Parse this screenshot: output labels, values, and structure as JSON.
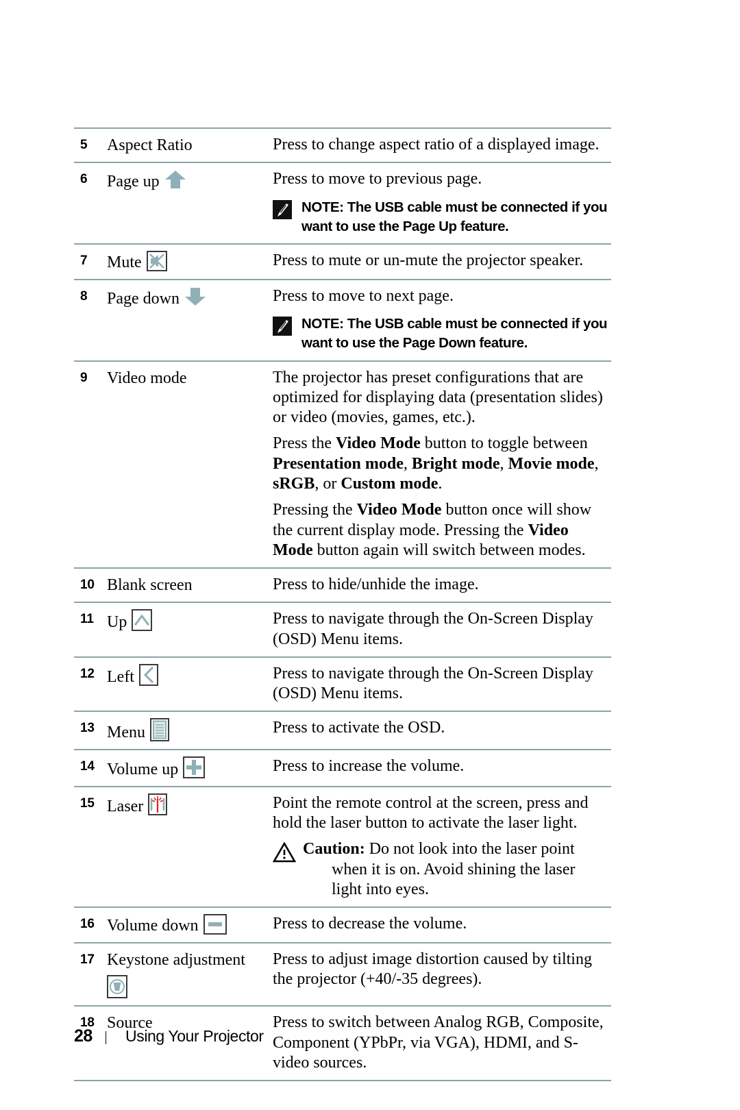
{
  "document": {
    "section_title": "Using Your Projector",
    "page_number": "28",
    "footer_separator": "|"
  },
  "colors": {
    "rule": "#8aa5a8",
    "icon_accent": "#8fb0b6",
    "icon_border": "#3a3a3a",
    "laser_red": "#e02020"
  },
  "table": {
    "rows": [
      {
        "num": "5",
        "name": "Aspect Ratio",
        "icon": "none",
        "paragraphs": [
          {
            "text": "Press to change aspect ratio of a displayed image."
          }
        ]
      },
      {
        "num": "6",
        "name": "Page up",
        "icon": "arrow-up-solid-icon",
        "paragraphs": [
          {
            "text": "Press to move to previous page."
          }
        ],
        "note": {
          "icon": "note-pencil-icon",
          "lead": "NOTE:",
          "body": "The USB cable must be connected if you want to use the Page Up feature."
        }
      },
      {
        "num": "7",
        "name": "Mute",
        "icon": "mute-icon",
        "paragraphs": [
          {
            "text": "Press to mute or un-mute the projector speaker."
          }
        ]
      },
      {
        "num": "8",
        "name": "Page down",
        "icon": "arrow-down-solid-icon",
        "paragraphs": [
          {
            "text": "Press to move to next page."
          }
        ],
        "note": {
          "icon": "note-pencil-icon",
          "lead": "NOTE:",
          "body": "The USB cable must be connected if you want to use the Page Down feature."
        }
      },
      {
        "num": "9",
        "name": "Video mode",
        "icon": "none",
        "paragraphs": [
          {
            "html": "The projector has preset configurations that are optimized for displaying data (presentation slides) or video (movies, games, etc.)."
          },
          {
            "html": "Press the <b>Video Mode</b> button to toggle between <b>Presentation mode</b>, <b>Bright mode</b>, <b>Movie mode</b>, <b>sRGB</b>, or <b>Custom mode</b>."
          },
          {
            "html": "Pressing the <b>Video Mode</b> button once will show the current display mode. Pressing the <b>Video Mode</b> button again will switch between modes."
          }
        ]
      },
      {
        "num": "10",
        "name": "Blank screen",
        "icon": "none",
        "paragraphs": [
          {
            "text": "Press to hide/unhide the image."
          }
        ]
      },
      {
        "num": "11",
        "name": "Up",
        "icon": "chevron-up-boxed-icon",
        "paragraphs": [
          {
            "text": "Press to navigate through the On-Screen Display (OSD) Menu items."
          }
        ]
      },
      {
        "num": "12",
        "name": "Left",
        "icon": "chevron-left-boxed-icon",
        "paragraphs": [
          {
            "text": "Press to navigate through the On-Screen Display (OSD) Menu items."
          }
        ]
      },
      {
        "num": "13",
        "name": "Menu",
        "icon": "menu-boxed-icon",
        "paragraphs": [
          {
            "text": "Press to activate the OSD."
          }
        ]
      },
      {
        "num": "14",
        "name": "Volume up",
        "icon": "plus-boxed-icon",
        "paragraphs": [
          {
            "text": "Press to increase the volume."
          }
        ]
      },
      {
        "num": "15",
        "name": "Laser",
        "icon": "laser-boxed-icon",
        "paragraphs": [
          {
            "text": "Point the remote control at the screen, press and hold the laser button to activate the laser light."
          }
        ],
        "caution": {
          "icon": "warning-triangle-icon",
          "lead": "Caution:",
          "body": "Do not look into the laser point",
          "continuation": "when it is on. Avoid shining the laser light into eyes."
        }
      },
      {
        "num": "16",
        "name": "Volume down",
        "icon": "minus-boxed-icon",
        "paragraphs": [
          {
            "text": "Press to decrease the volume."
          }
        ]
      },
      {
        "num": "17",
        "name": "Keystone adjustment",
        "icon": "keystone-boxed-icon",
        "icon_below": true,
        "paragraphs": [
          {
            "text": "Press to adjust image distortion caused by tilting the projector (+40/-35 degrees)."
          }
        ]
      },
      {
        "num": "18",
        "name": "Source",
        "icon": "none",
        "paragraphs": [
          {
            "text": "Press to switch between Analog RGB, Composite, Component (YPbPr, via VGA), HDMI, and S-video sources."
          }
        ]
      }
    ]
  }
}
